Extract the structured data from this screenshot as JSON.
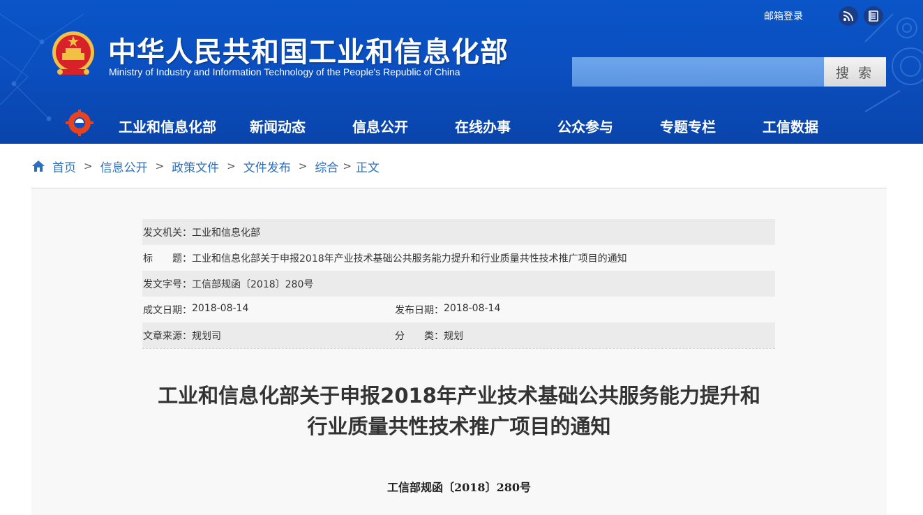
{
  "header": {
    "title_cn": "中华人民共和国工业和信息化部",
    "title_en": "Ministry of Industry and Information Technology of the People's Republic of China",
    "mail_link": "邮箱登录",
    "rss_icon": "rss-icon",
    "weibo_icon": "weibo-icon",
    "search": {
      "placeholder": "",
      "button_label": "搜 索"
    },
    "brand_colors": {
      "header_blue": "#0b4fc0",
      "link_blue": "#2c6fbe"
    }
  },
  "nav": {
    "items": [
      {
        "label": "工业和信息化部"
      },
      {
        "label": "新闻动态"
      },
      {
        "label": "信息公开"
      },
      {
        "label": "在线办事"
      },
      {
        "label": "公众参与"
      },
      {
        "label": "专题专栏"
      },
      {
        "label": "工信数据"
      }
    ]
  },
  "breadcrumb": {
    "items": [
      "首页",
      "信息公开",
      "政策文件",
      "文件发布",
      "综合"
    ],
    "current": "正文",
    "separator": ">"
  },
  "meta": {
    "issuer_label": "发文机关：",
    "issuer": "工业和信息化部",
    "title_label": "标　　题：",
    "title": "工业和信息化部关于申报2018年产业技术基础公共服务能力提升和行业质量共性技术推广项目的通知",
    "doc_no_label": "发文字号：",
    "doc_no": "工信部规函〔2018〕280号",
    "created_label": "成文日期：",
    "created": "2018-08-14",
    "published_label": "发布日期：",
    "published": "2018-08-14",
    "source_label": "文章来源：",
    "source": "规划司",
    "category_label": "分　　类：",
    "category": "规划"
  },
  "document": {
    "title_line1": "工业和信息化部关于申报2018年产业技术基础公共服务能力提升和",
    "title_line2": "行业质量共性技术推广项目的通知",
    "number": "工信部规函〔2018〕280号"
  }
}
